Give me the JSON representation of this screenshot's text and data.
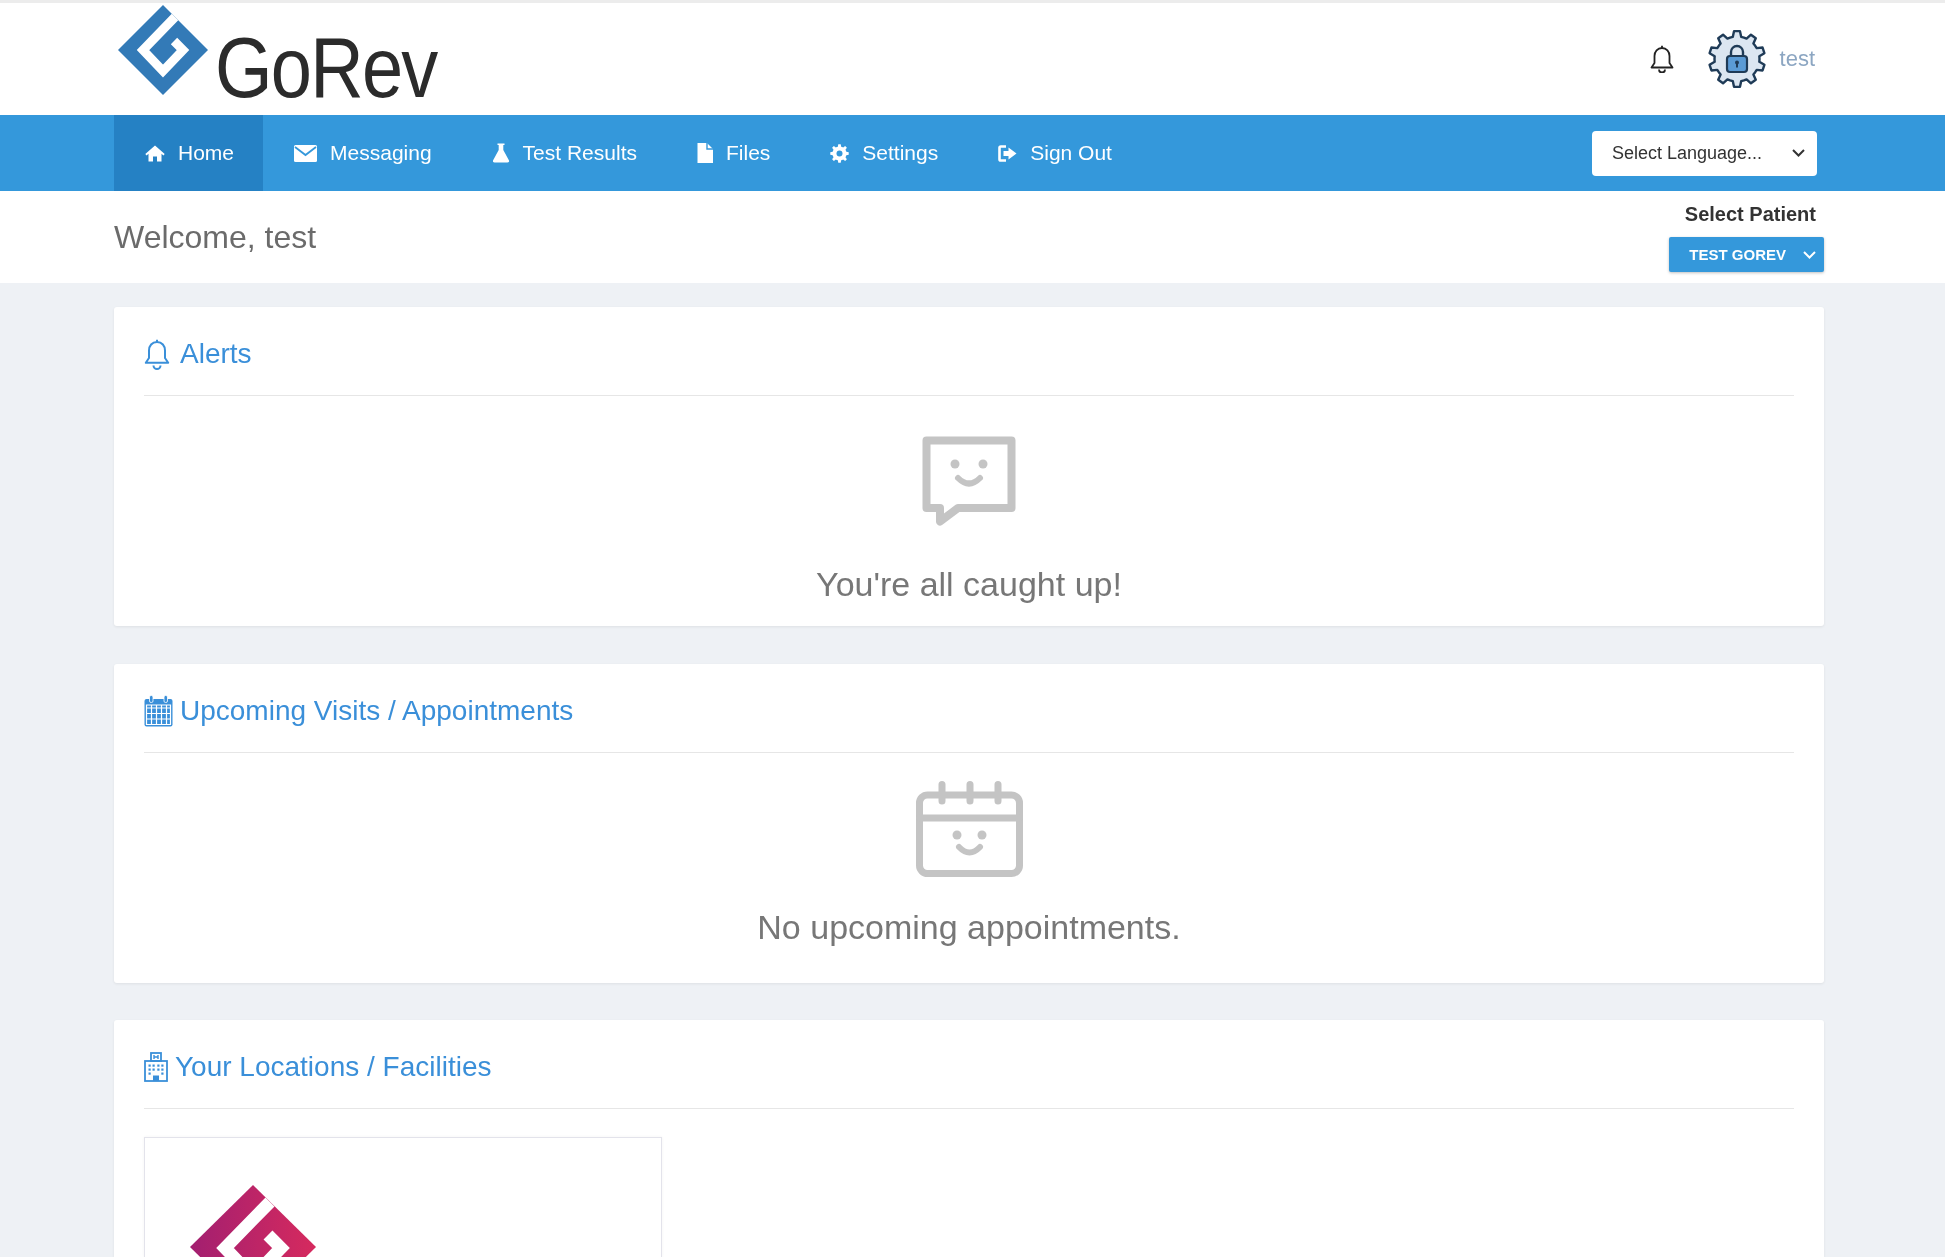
{
  "header": {
    "logo_text": "GoRev",
    "user_name": "test"
  },
  "nav": {
    "items": [
      {
        "label": "Home",
        "selected": true
      },
      {
        "label": "Messaging",
        "selected": false
      },
      {
        "label": "Test Results",
        "selected": false
      },
      {
        "label": "Files",
        "selected": false
      },
      {
        "label": "Settings",
        "selected": false
      },
      {
        "label": "Sign Out",
        "selected": false
      }
    ],
    "language_select": {
      "value": "Select Language..."
    }
  },
  "welcome_bar": {
    "greeting": "Welcome, test",
    "patient_label": "Select Patient",
    "patient_select": {
      "value": "TEST GOREV"
    }
  },
  "cards": [
    {
      "kind": "empty",
      "title": "Alerts",
      "message": "You're all caught up!"
    },
    {
      "kind": "empty",
      "title": "Upcoming Visits / Appointments",
      "message": "No upcoming appointments."
    },
    {
      "kind": "facilities",
      "title": "Your Locations / Facilities"
    }
  ]
}
